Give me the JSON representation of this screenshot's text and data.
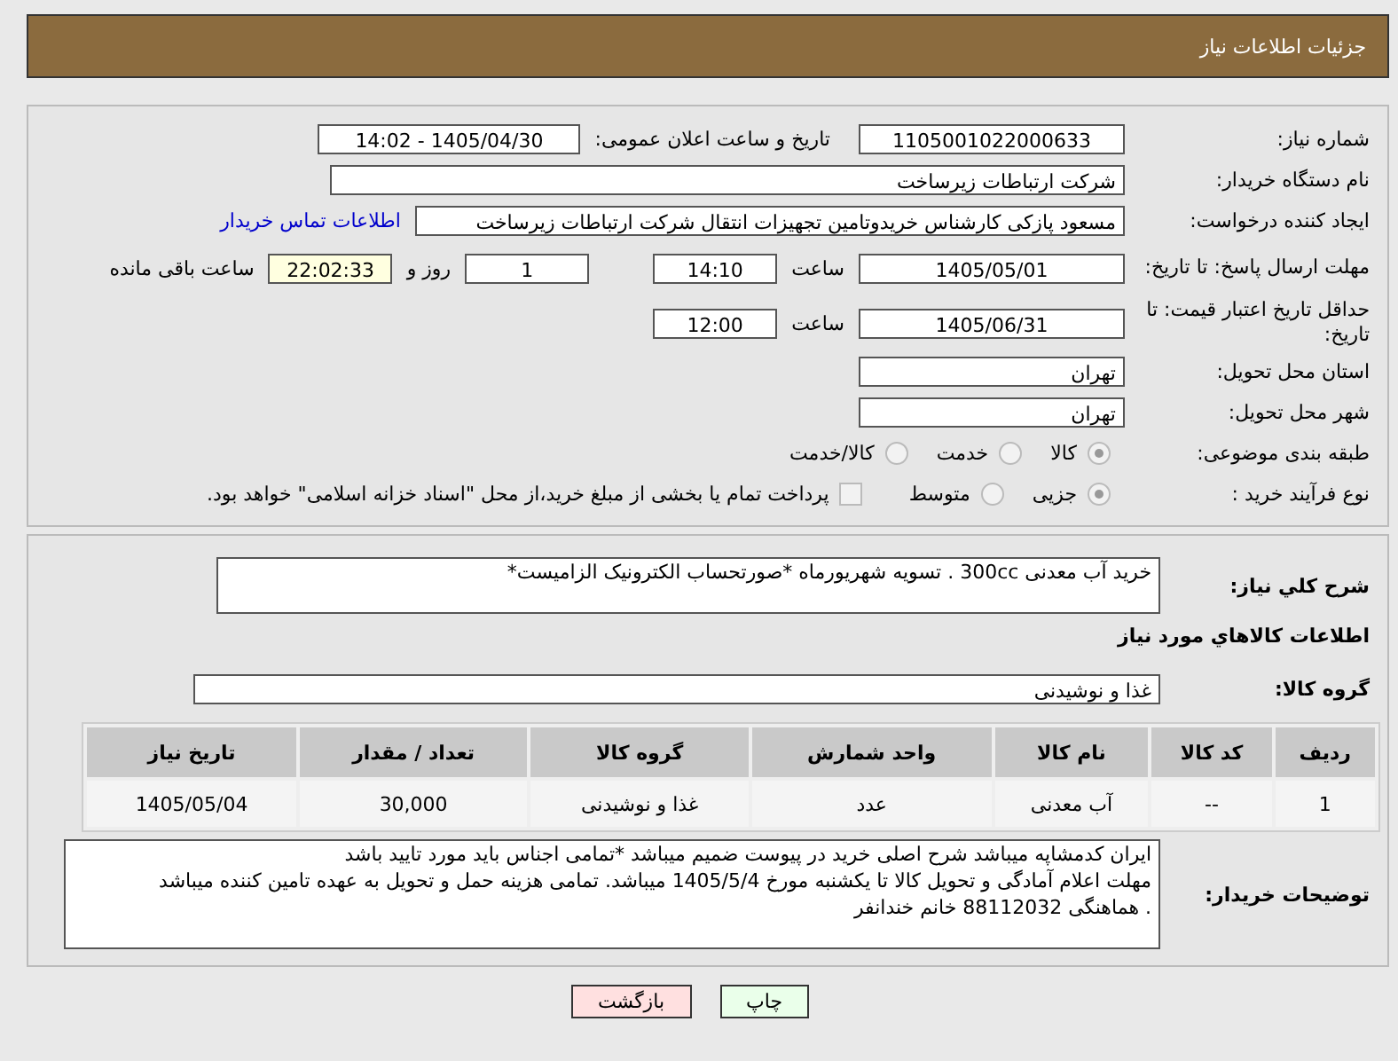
{
  "header": {
    "title": "جزئیات اطلاعات نیاز"
  },
  "need_number": {
    "label": "شماره نیاز:",
    "value": "1105001022000633"
  },
  "announce": {
    "label": "تاریخ و ساعت اعلان عمومی:",
    "value": "1405/04/30 - 14:02"
  },
  "buyer_org": {
    "label": "نام دستگاه خریدار:",
    "value": "شرکت ارتباطات زیرساخت"
  },
  "creator": {
    "label": "ایجاد کننده درخواست:",
    "value": "مسعود پازکی کارشناس خریدوتامین تجهیزات انتقال شرکت ارتباطات زیرساخت",
    "link": "اطلاعات تماس خریدار"
  },
  "reply_deadline": {
    "label": "مهلت ارسال پاسخ: تا تاریخ:",
    "date": "1405/05/01",
    "time_label": "ساعت",
    "time": "14:10",
    "days": "1",
    "days_label": "روز و",
    "remaining": "22:02:33",
    "remaining_label": "ساعت باقی مانده"
  },
  "price_validity": {
    "label": "حداقل تاریخ اعتبار قیمت: تا تاریخ:",
    "date": "1405/06/31",
    "time_label": "ساعت",
    "time": "12:00"
  },
  "province": {
    "label": "استان محل تحویل:",
    "value": "تهران"
  },
  "city": {
    "label": "شهر محل تحویل:",
    "value": "تهران"
  },
  "category": {
    "label": "طبقه بندی موضوعی:",
    "options": [
      {
        "label": "کالا",
        "selected": true
      },
      {
        "label": "خدمت",
        "selected": false
      },
      {
        "label": "کالا/خدمت",
        "selected": false
      }
    ]
  },
  "process": {
    "label": "نوع فرآیند خرید :",
    "options": [
      {
        "label": "جزیی",
        "selected": true
      },
      {
        "label": "متوسط",
        "selected": false
      }
    ],
    "payment_note": {
      "label": "پرداخت تمام یا بخشی از مبلغ خرید،از محل \"اسناد خزانه اسلامی\" خواهد بود.",
      "checked": false
    }
  },
  "description": {
    "label": "شرح کلي نياز:",
    "value": "خرید آب معدنی 300cc . تسویه شهریورماه *صورتحساب الکترونیک الزامیست*"
  },
  "goods_title": "اطلاعات کالاهاي مورد نياز",
  "goods_group": {
    "label": "گروه کالا:",
    "value": "غذا و نوشیدنی"
  },
  "table": {
    "columns": [
      "ردیف",
      "کد کالا",
      "نام کالا",
      "واحد شمارش",
      "گروه کالا",
      "تعداد / مقدار",
      "تاریخ نیاز"
    ],
    "rows": [
      [
        "1",
        "--",
        "آب معدنی",
        "عدد",
        "غذا و نوشیدنی",
        "30,000",
        "1405/05/04"
      ]
    ]
  },
  "buyer_notes": {
    "label": "توضیحات خریدار:",
    "value": "ایران کدمشاپه میباشد شرح اصلی خرید در پیوست ضمیم میباشد *تمامی اجناس باید مورد تایید  باشد\nمهلت اعلام آمادگی و تحویل کالا تا یکشنبه مورخ 1405/5/4 میباشد. تمامی هزینه حمل و تحویل به عهده تامین کننده میباشد\n. هماهنگی 88112032 خانم خندانفر"
  },
  "buttons": [
    {
      "label": "چاپ",
      "kind": "print"
    },
    {
      "label": "بازگشت",
      "kind": "back"
    }
  ]
}
